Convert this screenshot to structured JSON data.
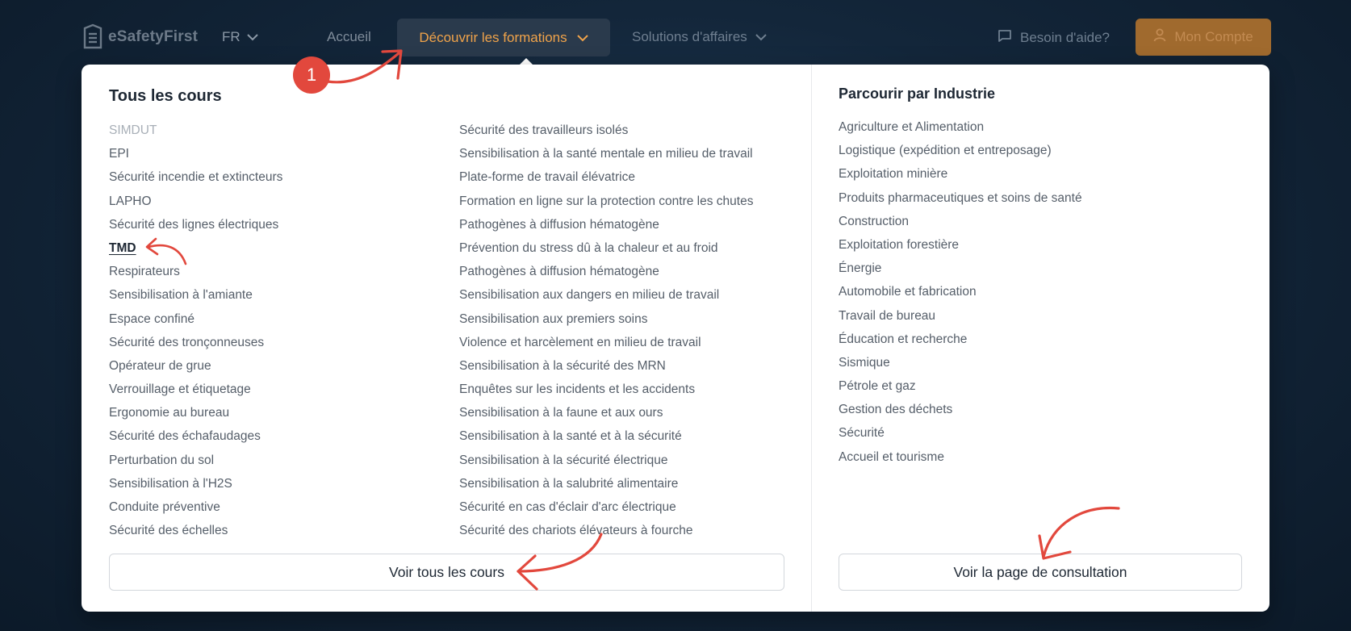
{
  "header": {
    "logo_text": "eSafetyFirst",
    "lang": "FR",
    "nav_home": "Accueil",
    "nav_formations": "Découvrir les formations",
    "nav_solutions": "Solutions d'affaires",
    "help": "Besoin d'aide?",
    "account": "Mon Compte"
  },
  "courses": {
    "title": "Tous les cours",
    "col1": [
      "SIMDUT",
      "EPI",
      "Sécurité incendie et extincteurs",
      "LAPHO",
      "Sécurité des lignes électriques",
      "TMD",
      "Respirateurs",
      "Sensibilisation à l'amiante",
      "Espace confiné",
      "Sécurité des tronçonneuses",
      "Opérateur de grue",
      "Verrouillage et étiquetage",
      "Ergonomie au bureau",
      "Sécurité des échafaudages",
      "Perturbation du sol",
      "Sensibilisation à l'H2S",
      "Conduite préventive",
      "Sécurité des échelles"
    ],
    "col2": [
      "Sécurité des travailleurs isolés",
      "Sensibilisation à la santé mentale en milieu de travail",
      "Plate-forme de travail élévatrice",
      "Formation en ligne sur la protection contre les chutes",
      "Pathogènes à diffusion hématogène",
      "Prévention du stress dû à la chaleur et au froid",
      "Pathogènes à diffusion hématogène",
      "Sensibilisation aux dangers en milieu de travail",
      "Sensibilisation aux premiers soins",
      "Violence et harcèlement en milieu de travail",
      "Sensibilisation à la sécurité des MRN",
      "Enquêtes sur les incidents et les accidents",
      "Sensibilisation à la faune et aux ours",
      "Sensibilisation à la santé et à la sécurité",
      "Sensibilisation à la sécurité électrique",
      "Sensibilisation à la salubrité alimentaire",
      "Sécurité en cas d'éclair d'arc électrique",
      "Sécurité des chariots élévateurs à fourche"
    ],
    "button": "Voir tous les cours"
  },
  "industries": {
    "title": "Parcourir par Industrie",
    "items": [
      "Agriculture et Alimentation",
      "Logistique (expédition et entreposage)",
      "Exploitation minière",
      "Produits pharmaceutiques et soins de santé",
      "Construction",
      "Exploitation forestière",
      "Énergie",
      "Automobile et fabrication",
      "Travail de bureau",
      "Éducation et recherche",
      "Sismique",
      "Pétrole et gaz",
      "Gestion des déchets",
      "Sécurité",
      "Accueil et tourisme"
    ],
    "button": "Voir la page de consultation"
  },
  "annotation": {
    "step_number": "1"
  },
  "colors": {
    "accent_orange": "#f0a34a",
    "annotation_red": "#e2483d",
    "account_bg": "#a06a2e",
    "text_dark": "#1d2733",
    "text_body": "#555e69",
    "text_muted": "#a8afb7"
  }
}
